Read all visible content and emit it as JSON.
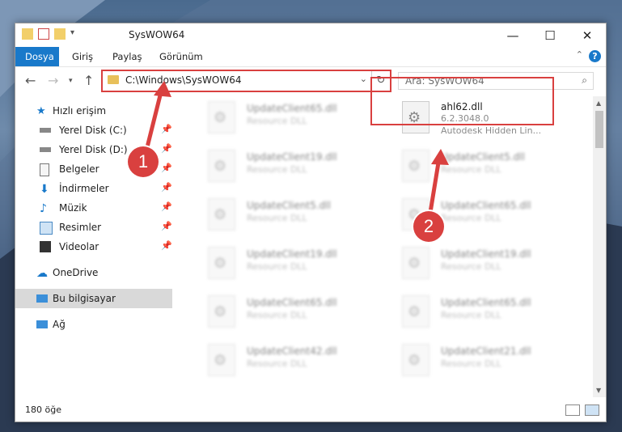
{
  "window": {
    "title": "SysWOW64",
    "controls": {
      "minimize": "—",
      "maximize": "☐",
      "close": "✕"
    }
  },
  "ribbon": {
    "tabs": [
      "Dosya",
      "Giriş",
      "Paylaş",
      "Görünüm"
    ],
    "help": "?"
  },
  "address": {
    "path": "C:\\Windows\\SysWOW64",
    "search_placeholder": "Ara: SysWOW64"
  },
  "sidebar": {
    "quick_access": "Hızlı erişim",
    "items": [
      {
        "label": "Yerel Disk (C:)",
        "icon": "drive-icon"
      },
      {
        "label": "Yerel Disk (D:)",
        "icon": "drive-icon"
      },
      {
        "label": "Belgeler",
        "icon": "document-icon"
      },
      {
        "label": "İndirmeler",
        "icon": "download-icon"
      },
      {
        "label": "Müzik",
        "icon": "music-icon"
      },
      {
        "label": "Resimler",
        "icon": "picture-icon"
      },
      {
        "label": "Videolar",
        "icon": "video-icon"
      }
    ],
    "onedrive": "OneDrive",
    "this_pc": "Bu bilgisayar",
    "network": "Ağ"
  },
  "files": {
    "highlighted": {
      "name": "ahl62.dll",
      "version": "6.2.3048.0",
      "description": "Autodesk Hidden Lin..."
    },
    "left_column": [
      {
        "name": "UpdateClient65.dll",
        "type": "Resource DLL"
      },
      {
        "name": "UpdateClient19.dll",
        "type": "Resource DLL"
      },
      {
        "name": "UpdateClient5.dll",
        "type": "Resource DLL"
      },
      {
        "name": "UpdateClient19.dll",
        "type": "Resource DLL"
      },
      {
        "name": "UpdateClient65.dll",
        "type": "Resource DLL"
      },
      {
        "name": "UpdateClient42.dll",
        "type": "Resource DLL"
      }
    ],
    "right_column": [
      {
        "name": "UpdateClient5.dll",
        "type": "Resource DLL"
      },
      {
        "name": "UpdateClient65.dll",
        "type": "Resource DLL"
      },
      {
        "name": "UpdateClient19.dll",
        "type": "Resource DLL"
      },
      {
        "name": "UpdateClient65.dll",
        "type": "Resource DLL"
      },
      {
        "name": "UpdateClient21.dll",
        "type": "Resource DLL"
      }
    ]
  },
  "status": {
    "count": "180 öğe"
  },
  "callouts": {
    "one": "1",
    "two": "2"
  },
  "colors": {
    "accent": "#1979ca",
    "callout": "#d9403f"
  }
}
